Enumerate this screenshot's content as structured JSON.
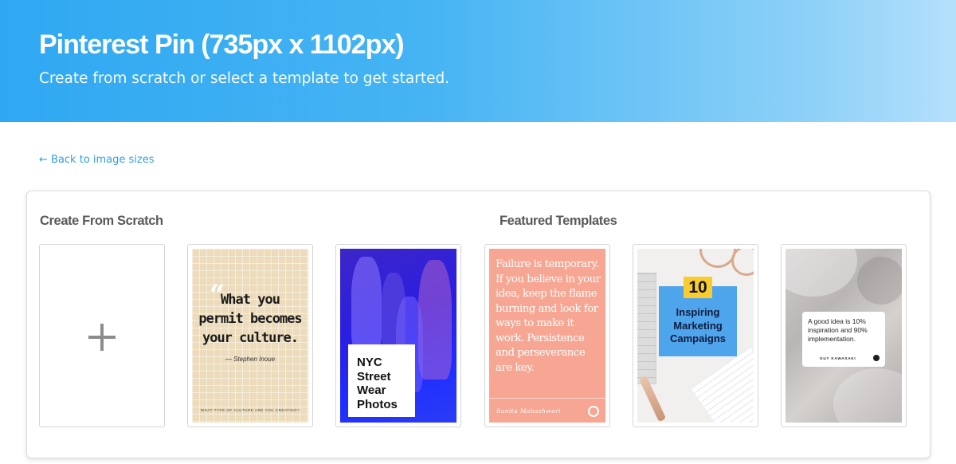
{
  "header": {
    "title": "Pinterest Pin (735px x 1102px)",
    "subtitle": "Create from scratch or select a template to get started."
  },
  "nav": {
    "back_link": "← Back to image sizes"
  },
  "sections": {
    "scratch_title": "Create From Scratch",
    "templates_title": "Featured Templates"
  },
  "templates": [
    {
      "lines": [
        "What you",
        "permit becomes",
        "your culture."
      ],
      "author": "— Stephen Inoue",
      "footer": "WHAT TYPE OF CULTURE ARE YOU CREATING?",
      "colors": {
        "background": "#ecdcbc"
      }
    },
    {
      "lines": [
        "NYC",
        "Street",
        "Wear",
        "Photos"
      ],
      "colors": {
        "background": "#2a1ee0"
      }
    },
    {
      "text": "Failure is temporary. If you believe in your idea, keep the flame burning and look for ways to make it work. Persistence and perseverance are key.",
      "author": "Sunita Mahashwari",
      "colors": {
        "background": "#f6a692"
      }
    },
    {
      "number": "10",
      "lines": [
        "Inspiring",
        "Marketing",
        "Campaigns"
      ],
      "colors": {
        "card": "#4fa5ec",
        "badge": "#f8cc2e"
      }
    },
    {
      "quote": "A good idea is 10% inspiration and 90% implementation.",
      "author": "GUY KAWASAKI",
      "colors": {
        "background": "#b9b5b4"
      }
    }
  ],
  "icons": {
    "create": "plus-icon",
    "back": "arrow-left-icon"
  },
  "colors": {
    "accent": "#2f9fe6",
    "hero_start": "#2fa8f2",
    "hero_end": "#b5e0fb"
  }
}
